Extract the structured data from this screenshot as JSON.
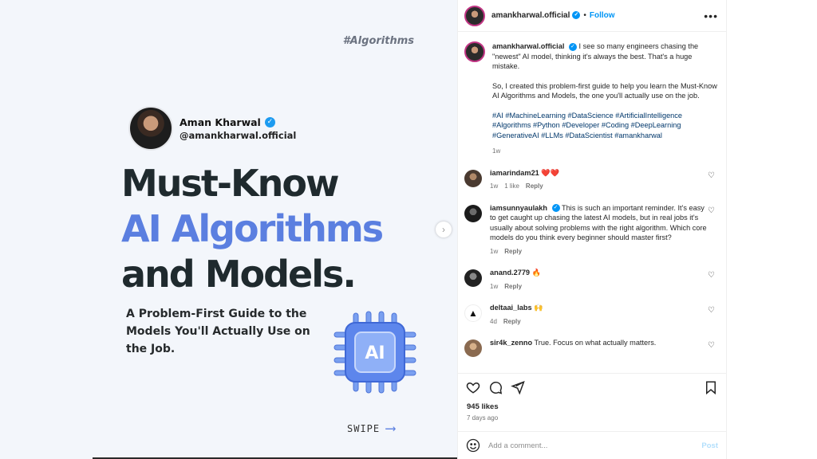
{
  "post_image": {
    "hashtag": "#Algorithms",
    "author_name": "Aman Kharwal",
    "author_handle": "@amankharwal.official",
    "headline_line1": "Must-Know",
    "headline_line2": "AI Algorithms",
    "headline_line3": "and Models.",
    "subheadline": "A Problem-First Guide to the Models You'll Actually Use on the Job.",
    "chip_label": "AI",
    "swipe_label": "SWIPE",
    "colors": {
      "accent": "#5b7fe0",
      "headline": "#1f2a2e",
      "background": "#f3f6fb"
    }
  },
  "header": {
    "username": "amankharwal.official",
    "separator": "•",
    "follow_label": "Follow",
    "more_label": "•••"
  },
  "caption": {
    "username": "amankharwal.official",
    "paragraph1": "I see so many engineers chasing the \"newest\" AI model, thinking it's always the best. That's a huge mistake.",
    "paragraph2": "So, I created this problem-first guide to help you learn the Must-Know AI Algorithms and Models, the one you'll actually use on the job.",
    "hashtags": "#AI #MachineLearning #DataScience #ArtificialIntelligence #Algorithms #Python #Developer #Coding #DeepLearning #GenerativeAI #LLMs #DataScientist #amankharwal",
    "age": "1w"
  },
  "comments": [
    {
      "username": "iamarindam21",
      "text": "❤️❤️",
      "age": "1w",
      "likes": "1 like",
      "reply": "Reply"
    },
    {
      "username": "iamsunnyaulakh",
      "text": "This is such an important reminder. It's easy to get caught up chasing the latest AI models, but in real jobs it's usually about solving problems with the right algorithm. Which core models do you think every beginner should master first?",
      "age": "1w",
      "reply": "Reply"
    },
    {
      "username": "anand.2779",
      "text": "🔥",
      "age": "1w",
      "reply": "Reply"
    },
    {
      "username": "deltaai_labs",
      "text": "🙌",
      "age": "4d",
      "reply": "Reply"
    },
    {
      "username": "sir4k_zenno",
      "text": "True. Focus on what actually matters."
    }
  ],
  "footer": {
    "likes": "945 likes",
    "age": "7 days ago",
    "comment_placeholder": "Add a comment...",
    "post_label": "Post"
  },
  "icons": {
    "heart": "heart-icon",
    "comment": "comment-icon",
    "share": "share-icon",
    "bookmark": "bookmark-icon",
    "emoji": "emoji-icon",
    "next": "chevron-right-icon"
  },
  "colors": {
    "link": "#0095f6",
    "hashtag": "#00376b",
    "muted": "#737373"
  }
}
